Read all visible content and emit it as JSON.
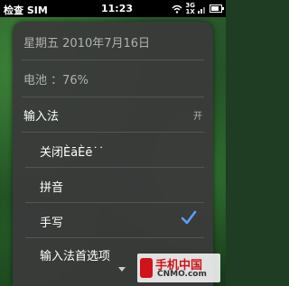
{
  "status_bar": {
    "carrier": "检查 SIM",
    "time": "11:23",
    "network_top": "3G",
    "network_bottom": "1X",
    "battery_level": 0.76
  },
  "menu": {
    "date": "星期五 2010年7月16日",
    "battery": "电池 ：76%",
    "input_method": {
      "label": "输入法",
      "toggle": "开"
    },
    "options": [
      {
        "label": "关闭ÈāÈē˙˙",
        "selected": false
      },
      {
        "label": "拼音",
        "selected": false
      },
      {
        "label": "手写",
        "selected": true
      },
      {
        "label": "输入法首选项",
        "selected": false
      }
    ],
    "check_color": "#5aa0ff"
  },
  "watermark": {
    "cn": "手机中国",
    "en": "CNMO.com"
  }
}
